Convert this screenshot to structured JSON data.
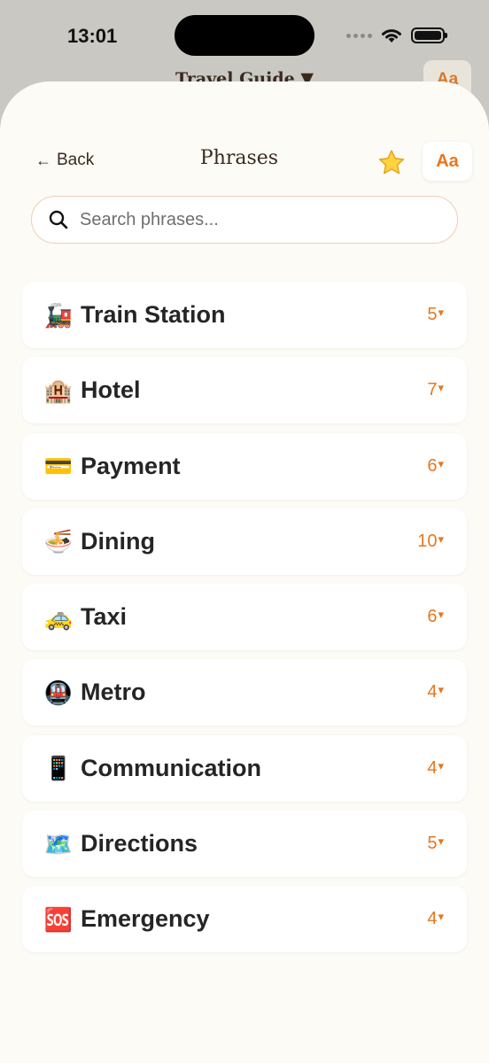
{
  "status_bar": {
    "time": "13:01"
  },
  "background": {
    "title": "Travel Guide ▼",
    "aa_label": "Aa"
  },
  "nav": {
    "back_label": "Back",
    "back_arrow": "←",
    "title": "Phrases",
    "aa_label": "Aa",
    "star_icon": "star-icon"
  },
  "search": {
    "placeholder": "Search phrases...",
    "value": ""
  },
  "colors": {
    "accent": "#e8771e",
    "sheet_bg": "#fcfbf6",
    "title_color": "#3b2a1c"
  },
  "categories": [
    {
      "emoji": "🚂",
      "icon": "train-icon",
      "label": "Train Station",
      "count": "5",
      "caret": "▾"
    },
    {
      "emoji": "🏨",
      "icon": "hotel-icon",
      "label": "Hotel",
      "count": "7",
      "caret": "▾"
    },
    {
      "emoji": "💳",
      "icon": "credit-card-icon",
      "label": "Payment",
      "count": "6",
      "caret": "▾"
    },
    {
      "emoji": "🍜",
      "icon": "noodle-bowl-icon",
      "label": "Dining",
      "count": "10",
      "caret": "▾"
    },
    {
      "emoji": "🚕",
      "icon": "taxi-icon",
      "label": "Taxi",
      "count": "6",
      "caret": "▾"
    },
    {
      "emoji": "🚇",
      "icon": "metro-icon",
      "label": "Metro",
      "count": "4",
      "caret": "▾"
    },
    {
      "emoji": "📱",
      "icon": "mobile-phone-icon",
      "label": "Communication",
      "count": "4",
      "caret": "▾"
    },
    {
      "emoji": "🗺️",
      "icon": "map-icon",
      "label": "Directions",
      "count": "5",
      "caret": "▾"
    },
    {
      "emoji": "🆘",
      "icon": "sos-icon",
      "label": "Emergency",
      "count": "4",
      "caret": "▾"
    }
  ]
}
